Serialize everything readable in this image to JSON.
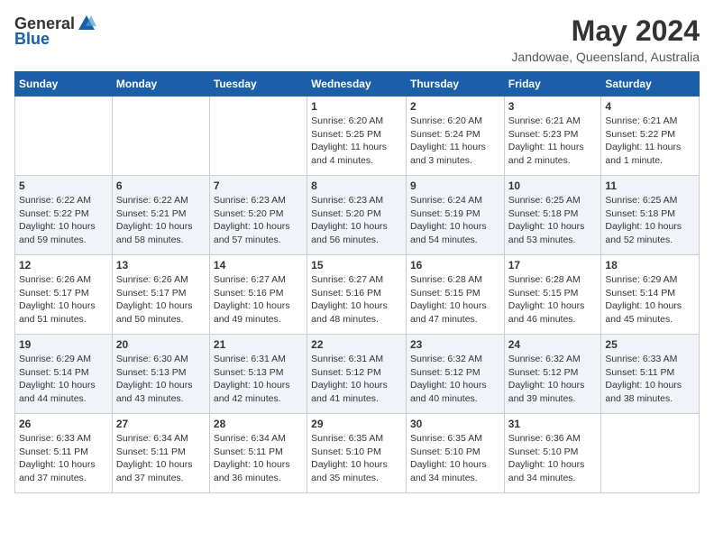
{
  "header": {
    "logo_general": "General",
    "logo_blue": "Blue",
    "month": "May 2024",
    "location": "Jandowae, Queensland, Australia"
  },
  "days_of_week": [
    "Sunday",
    "Monday",
    "Tuesday",
    "Wednesday",
    "Thursday",
    "Friday",
    "Saturday"
  ],
  "weeks": [
    [
      {
        "num": "",
        "info": ""
      },
      {
        "num": "",
        "info": ""
      },
      {
        "num": "",
        "info": ""
      },
      {
        "num": "1",
        "info": "Sunrise: 6:20 AM\nSunset: 5:25 PM\nDaylight: 11 hours\nand 4 minutes."
      },
      {
        "num": "2",
        "info": "Sunrise: 6:20 AM\nSunset: 5:24 PM\nDaylight: 11 hours\nand 3 minutes."
      },
      {
        "num": "3",
        "info": "Sunrise: 6:21 AM\nSunset: 5:23 PM\nDaylight: 11 hours\nand 2 minutes."
      },
      {
        "num": "4",
        "info": "Sunrise: 6:21 AM\nSunset: 5:22 PM\nDaylight: 11 hours\nand 1 minute."
      }
    ],
    [
      {
        "num": "5",
        "info": "Sunrise: 6:22 AM\nSunset: 5:22 PM\nDaylight: 10 hours\nand 59 minutes."
      },
      {
        "num": "6",
        "info": "Sunrise: 6:22 AM\nSunset: 5:21 PM\nDaylight: 10 hours\nand 58 minutes."
      },
      {
        "num": "7",
        "info": "Sunrise: 6:23 AM\nSunset: 5:20 PM\nDaylight: 10 hours\nand 57 minutes."
      },
      {
        "num": "8",
        "info": "Sunrise: 6:23 AM\nSunset: 5:20 PM\nDaylight: 10 hours\nand 56 minutes."
      },
      {
        "num": "9",
        "info": "Sunrise: 6:24 AM\nSunset: 5:19 PM\nDaylight: 10 hours\nand 54 minutes."
      },
      {
        "num": "10",
        "info": "Sunrise: 6:25 AM\nSunset: 5:18 PM\nDaylight: 10 hours\nand 53 minutes."
      },
      {
        "num": "11",
        "info": "Sunrise: 6:25 AM\nSunset: 5:18 PM\nDaylight: 10 hours\nand 52 minutes."
      }
    ],
    [
      {
        "num": "12",
        "info": "Sunrise: 6:26 AM\nSunset: 5:17 PM\nDaylight: 10 hours\nand 51 minutes."
      },
      {
        "num": "13",
        "info": "Sunrise: 6:26 AM\nSunset: 5:17 PM\nDaylight: 10 hours\nand 50 minutes."
      },
      {
        "num": "14",
        "info": "Sunrise: 6:27 AM\nSunset: 5:16 PM\nDaylight: 10 hours\nand 49 minutes."
      },
      {
        "num": "15",
        "info": "Sunrise: 6:27 AM\nSunset: 5:16 PM\nDaylight: 10 hours\nand 48 minutes."
      },
      {
        "num": "16",
        "info": "Sunrise: 6:28 AM\nSunset: 5:15 PM\nDaylight: 10 hours\nand 47 minutes."
      },
      {
        "num": "17",
        "info": "Sunrise: 6:28 AM\nSunset: 5:15 PM\nDaylight: 10 hours\nand 46 minutes."
      },
      {
        "num": "18",
        "info": "Sunrise: 6:29 AM\nSunset: 5:14 PM\nDaylight: 10 hours\nand 45 minutes."
      }
    ],
    [
      {
        "num": "19",
        "info": "Sunrise: 6:29 AM\nSunset: 5:14 PM\nDaylight: 10 hours\nand 44 minutes."
      },
      {
        "num": "20",
        "info": "Sunrise: 6:30 AM\nSunset: 5:13 PM\nDaylight: 10 hours\nand 43 minutes."
      },
      {
        "num": "21",
        "info": "Sunrise: 6:31 AM\nSunset: 5:13 PM\nDaylight: 10 hours\nand 42 minutes."
      },
      {
        "num": "22",
        "info": "Sunrise: 6:31 AM\nSunset: 5:12 PM\nDaylight: 10 hours\nand 41 minutes."
      },
      {
        "num": "23",
        "info": "Sunrise: 6:32 AM\nSunset: 5:12 PM\nDaylight: 10 hours\nand 40 minutes."
      },
      {
        "num": "24",
        "info": "Sunrise: 6:32 AM\nSunset: 5:12 PM\nDaylight: 10 hours\nand 39 minutes."
      },
      {
        "num": "25",
        "info": "Sunrise: 6:33 AM\nSunset: 5:11 PM\nDaylight: 10 hours\nand 38 minutes."
      }
    ],
    [
      {
        "num": "26",
        "info": "Sunrise: 6:33 AM\nSunset: 5:11 PM\nDaylight: 10 hours\nand 37 minutes."
      },
      {
        "num": "27",
        "info": "Sunrise: 6:34 AM\nSunset: 5:11 PM\nDaylight: 10 hours\nand 37 minutes."
      },
      {
        "num": "28",
        "info": "Sunrise: 6:34 AM\nSunset: 5:11 PM\nDaylight: 10 hours\nand 36 minutes."
      },
      {
        "num": "29",
        "info": "Sunrise: 6:35 AM\nSunset: 5:10 PM\nDaylight: 10 hours\nand 35 minutes."
      },
      {
        "num": "30",
        "info": "Sunrise: 6:35 AM\nSunset: 5:10 PM\nDaylight: 10 hours\nand 34 minutes."
      },
      {
        "num": "31",
        "info": "Sunrise: 6:36 AM\nSunset: 5:10 PM\nDaylight: 10 hours\nand 34 minutes."
      },
      {
        "num": "",
        "info": ""
      }
    ]
  ]
}
